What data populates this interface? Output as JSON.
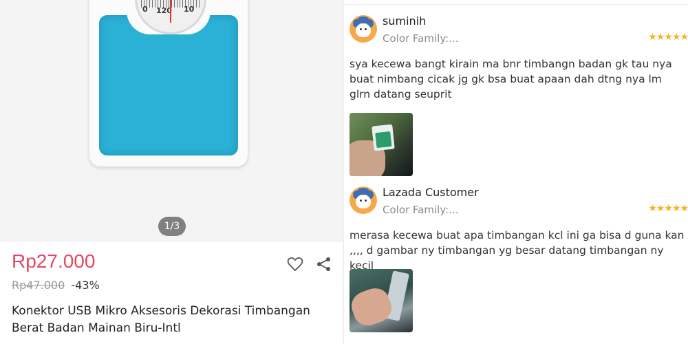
{
  "product": {
    "gallery": {
      "dial_left_number": "0",
      "dial_mid_number": "120",
      "dial_right_number": "10",
      "page_indicator": "1/3"
    },
    "price": "Rp27.000",
    "original_price": "Rp47.000",
    "discount": "-43%",
    "title": "Konektor USB Mikro Aksesoris Dekorasi Timbangan Berat Badan Mainan Biru-Intl",
    "actions": [
      "heart-icon",
      "share-icon"
    ],
    "colors": {
      "price": "#e5475f",
      "scale_pad": "#2bb0d6"
    }
  },
  "reviews": [
    {
      "name": "suminih",
      "variant": "Color Family:...",
      "rating": 5,
      "stars": "★★★★★",
      "text": "sya kecewa bangt kirain ma bnr timbangn badan gk tau nya buat nimbang cicak jg gk bsa buat apaan dah dtng nya lm glrn datang seuprit",
      "has_photo": true
    },
    {
      "name": "Lazada Customer",
      "variant": "Color Family:...",
      "rating": 5,
      "stars": "★★★★★",
      "text": "merasa kecewa buat apa timbangan kcl ini ga bisa d guna kan ,,,, d gambar ny timbangan yg besar datang timbangan ny kecil",
      "has_photo": true
    }
  ],
  "colors": {
    "stars": "#f7b21f",
    "avatar": "#f7a94a"
  }
}
